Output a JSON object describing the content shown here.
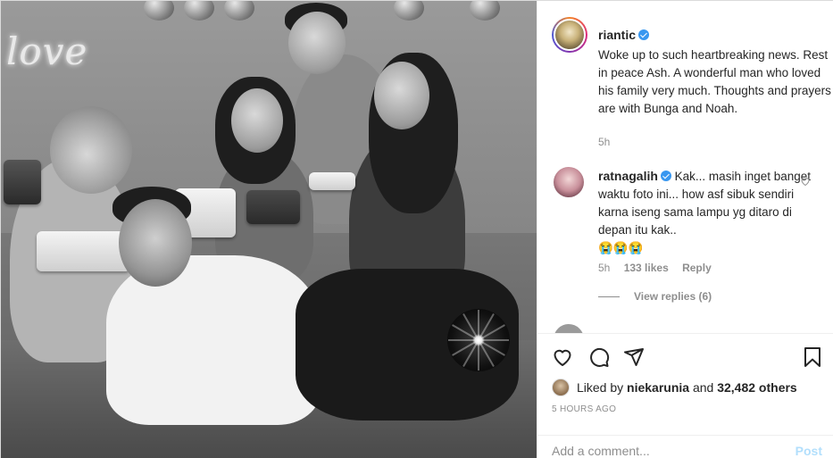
{
  "post": {
    "author": "riantic",
    "caption": "Woke up to such heartbreaking news. Rest in peace Ash. A wonderful man who loved his family very much. Thoughts and prayers are with Bunga and Noah.",
    "time_ago": "5h",
    "photo_neon_text": "love"
  },
  "comments": [
    {
      "author": "ratnagalih",
      "text": "Kak... masih inget banget waktu foto ini... how asf sibuk sendiri karna iseng sama lampu yg ditaro di depan itu kak..",
      "emojis": "😭😭😭",
      "time_ago": "5h",
      "likes": "133 likes",
      "reply_label": "Reply",
      "view_replies": "View replies (6)"
    }
  ],
  "actions": {
    "like_icon": "heart-icon",
    "comment_icon": "comment-icon",
    "share_icon": "share-icon",
    "save_icon": "bookmark-icon"
  },
  "likes": {
    "prefix": "Liked by",
    "user": "niekarunia",
    "connector": "and",
    "others": "32,482 others"
  },
  "timestamp": "5 HOURS AGO",
  "comment_box": {
    "placeholder": "Add a comment...",
    "post_label": "Post"
  },
  "colors": {
    "verified": "#3897f0",
    "post_button_disabled": "#b2dffc",
    "muted_text": "#8e8e8e"
  }
}
